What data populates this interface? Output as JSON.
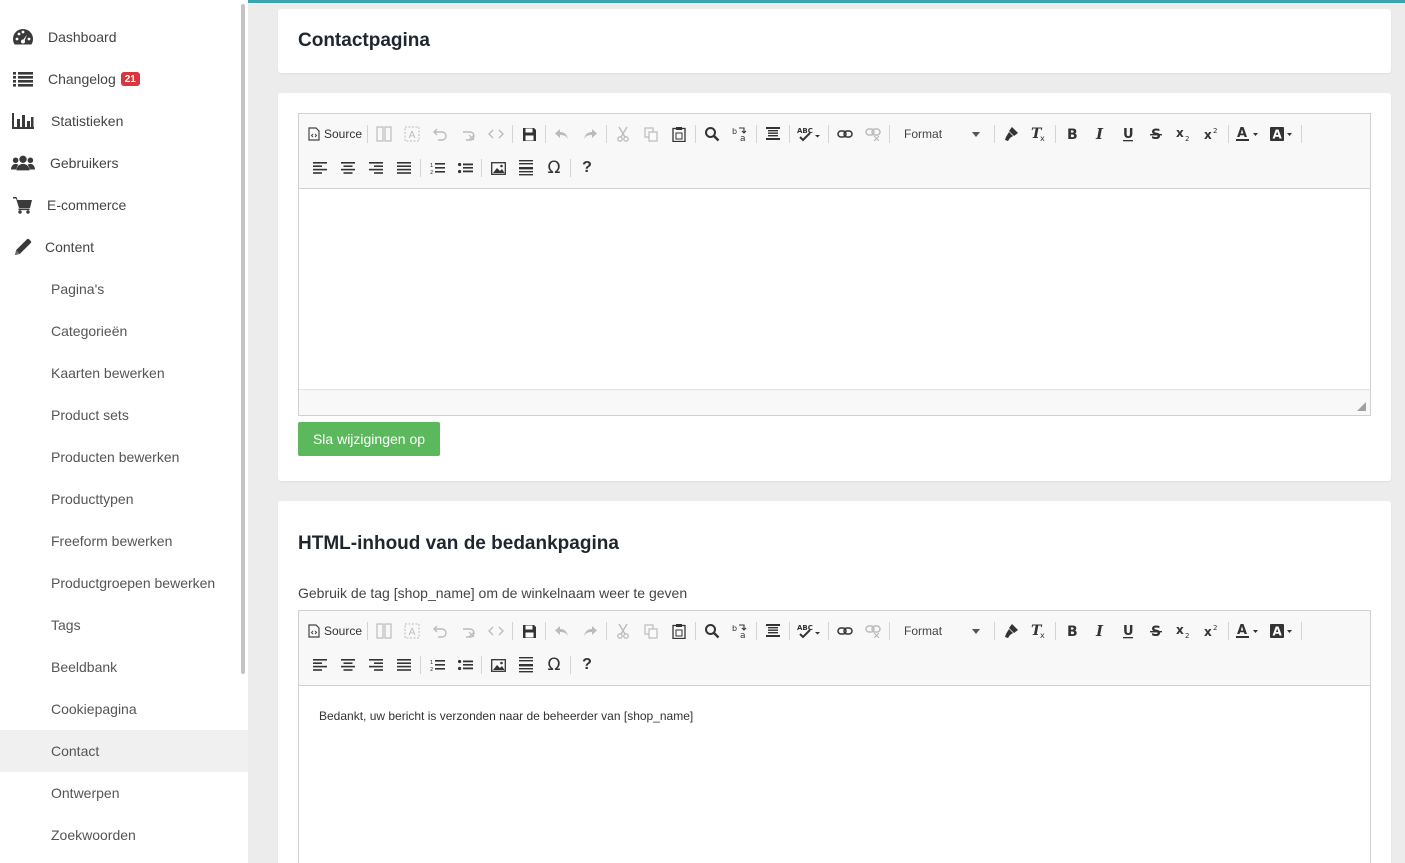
{
  "sidebar": {
    "main": [
      {
        "label": "Dashboard",
        "icon": "dashboard-icon"
      },
      {
        "label": "Changelog",
        "icon": "list-icon",
        "badge": "21"
      },
      {
        "label": "Statistieken",
        "icon": "bar-chart-icon"
      },
      {
        "label": "Gebruikers",
        "icon": "users-icon"
      },
      {
        "label": "E-commerce",
        "icon": "cart-icon"
      },
      {
        "label": "Content",
        "icon": "pencil-icon"
      }
    ],
    "sub": [
      {
        "label": "Pagina's"
      },
      {
        "label": "Categorieën"
      },
      {
        "label": "Kaarten bewerken"
      },
      {
        "label": "Product sets"
      },
      {
        "label": "Producten bewerken"
      },
      {
        "label": "Producttypen"
      },
      {
        "label": "Freeform bewerken"
      },
      {
        "label": "Productgroepen bewerken"
      },
      {
        "label": "Tags"
      },
      {
        "label": "Beeldbank"
      },
      {
        "label": "Cookiepagina"
      },
      {
        "label": "Contact",
        "active": true
      },
      {
        "label": "Ontwerpen"
      },
      {
        "label": "Zoekwoorden"
      }
    ]
  },
  "page": {
    "title": "Contactpagina"
  },
  "editor": {
    "source_label": "Source",
    "format_label": "Format"
  },
  "form": {
    "save_label": "Sla wijzigingen op"
  },
  "thanks": {
    "title": "HTML-inhoud van de bedankpagina",
    "hint": "Gebruik de tag [shop_name] om de winkelnaam weer te geven",
    "content": "Bedankt, uw bericht is verzonden naar de beheerder van [shop_name]"
  },
  "colors": {
    "accent": "#3aa5ad",
    "save_button": "#5cb85c",
    "badge": "#d9363e"
  }
}
